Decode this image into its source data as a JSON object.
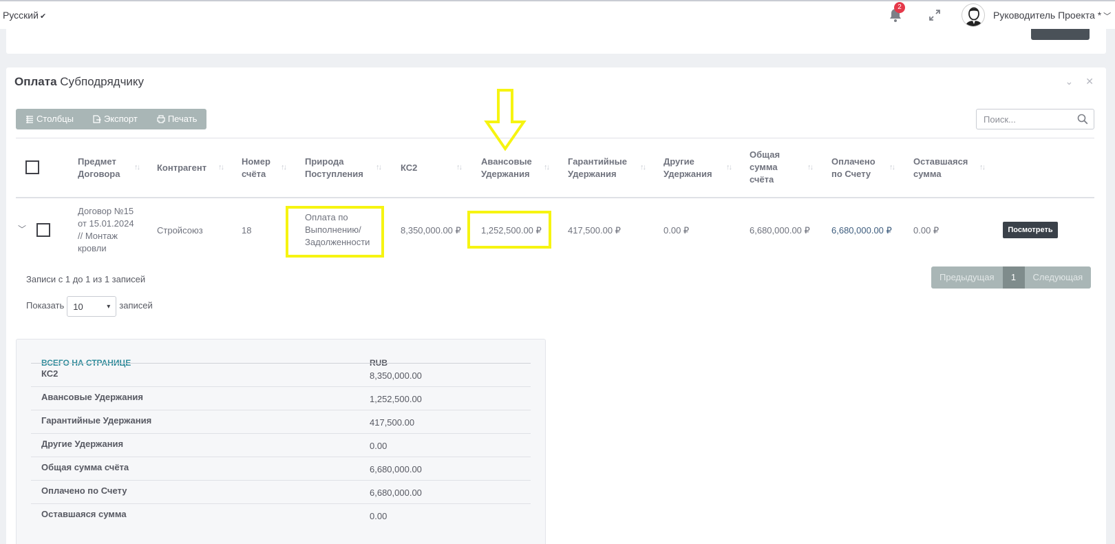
{
  "topbar": {
    "language": "Русский",
    "notifications_count": "2",
    "user_name": "Руководитель Проекта *"
  },
  "card": {
    "title_bold": "Оплата",
    "title_rest": "Субподрядчику"
  },
  "toolbar": {
    "columns_label": "Столбцы",
    "export_label": "Экспорт",
    "print_label": "Печать"
  },
  "search": {
    "placeholder": "Поиск..."
  },
  "table": {
    "headers": {
      "subject_l1": "Предмет",
      "subject_l2": "Договора",
      "counterparty": "Контрагент",
      "invoice_l1": "Номер",
      "invoice_l2": "счёта",
      "nature_l1": "Природа",
      "nature_l2": "Поступления",
      "ks2": "КС2",
      "advance_l1": "Авансовые",
      "advance_l2": "Удержания",
      "warranty_l1": "Гарантийные",
      "warranty_l2": "Удержания",
      "other_l1": "Другие",
      "other_l2": "Удержания",
      "total_l1": "Общая",
      "total_l2": "сумма",
      "total_l3": "счёта",
      "paid_l1": "Оплачено",
      "paid_l2": "по Счету",
      "remaining_l1": "Оставшаяся",
      "remaining_l2": "сумма"
    },
    "row": {
      "subject_l1": "Договор №15",
      "subject_l2": "от 15.01.2024",
      "subject_l3": "// Монтаж",
      "subject_l4": "кровли",
      "counterparty": "Стройсоюз",
      "invoice": "18",
      "nature_l1": "Оплата по",
      "nature_l2": "Выполнению/",
      "nature_l3": "Задолженности",
      "ks2": "8,350,000.00 ₽",
      "advance": "1,252,500.00 ₽",
      "warranty": "417,500.00 ₽",
      "other": "0.00 ₽",
      "total": "6,680,000.00 ₽",
      "paid": "6,680,000.00 ₽",
      "remaining": "0.00 ₽",
      "view_label": "Посмотреть"
    }
  },
  "footer": {
    "info": "Записи с 1 до 1 из 1 записей",
    "show_label": "Показать",
    "page_size": "10",
    "records_label": "записей",
    "prev": "Предыдущая",
    "page": "1",
    "next": "Следующая"
  },
  "totals": {
    "header_label": "ВСЕГО НА СТРАНИЦЕ",
    "currency": "RUB",
    "rows": [
      {
        "label": "КС2",
        "value": "8,350,000.00"
      },
      {
        "label": "Авансовые Удержания",
        "value": "1,252,500.00"
      },
      {
        "label": "Гарантийные Удержания",
        "value": "417,500.00"
      },
      {
        "label": "Другие Удержания",
        "value": "0.00"
      },
      {
        "label": "Общая сумма счёта",
        "value": "6,680,000.00"
      },
      {
        "label": "Оплачено по Счету",
        "value": "6,680,000.00"
      },
      {
        "label": "Оставшаяся сумма",
        "value": "0.00"
      }
    ]
  },
  "colors": {
    "highlight": "#f6f411",
    "accent_teal": "#2e8b9a",
    "badge_red": "#e5394a"
  }
}
